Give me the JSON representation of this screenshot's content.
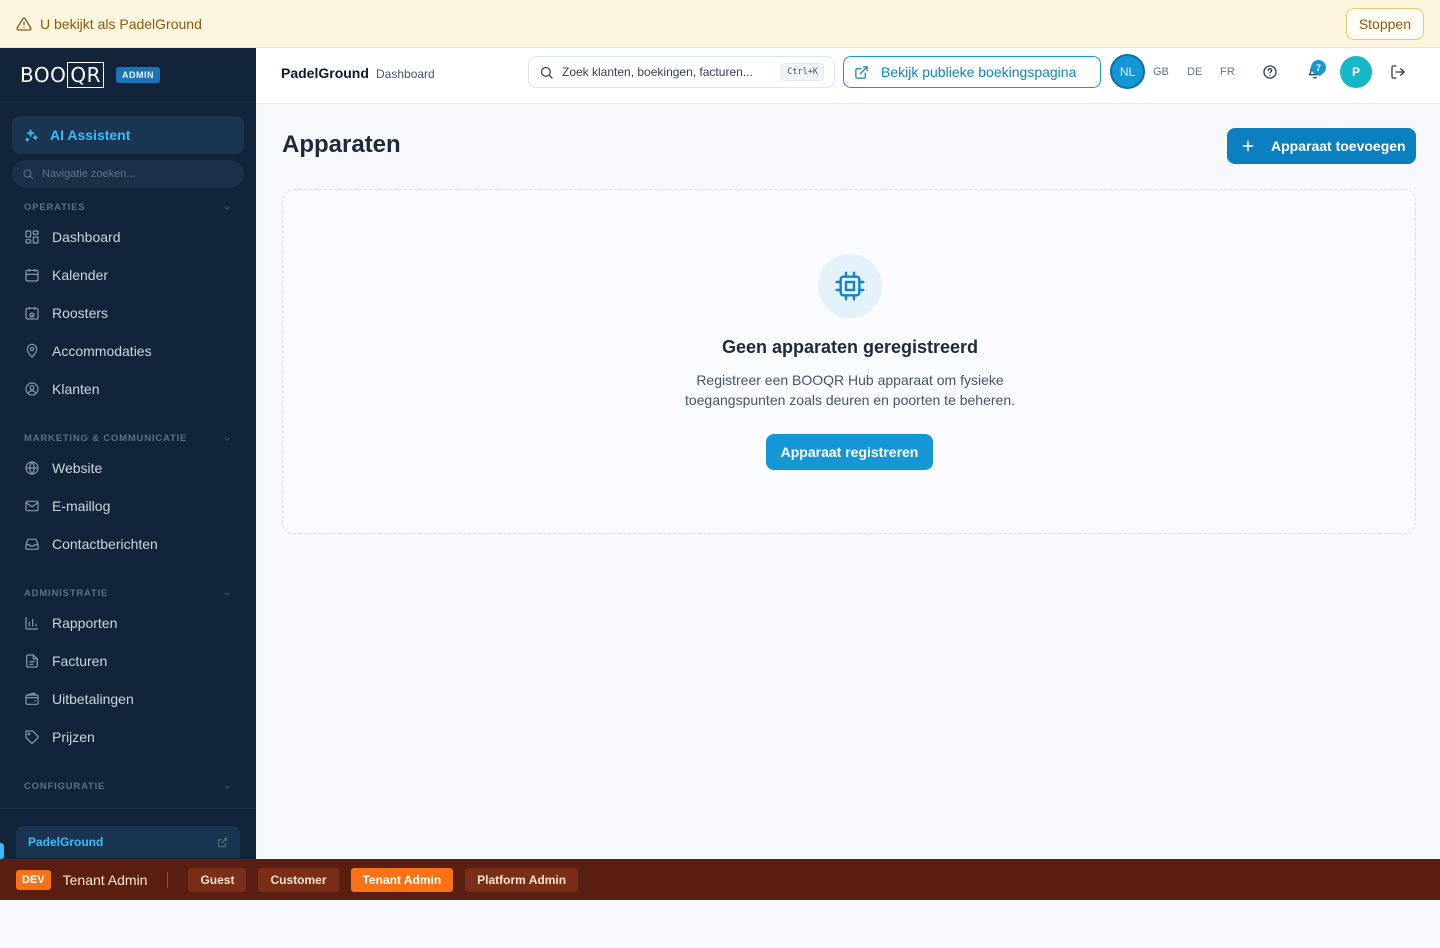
{
  "banner": {
    "text": "U bekijkt als PadelGround",
    "stop_label": "Stoppen"
  },
  "sidebar": {
    "logo": {
      "text_a": "BOO",
      "text_b": "QR"
    },
    "admin_badge": "ADMIN",
    "ai_label": "AI Assistent",
    "search_placeholder": "Navigatie zoeken...",
    "sections": [
      {
        "label": "OPERATIES"
      },
      {
        "label": "MARKETING & COMMUNICATIE"
      },
      {
        "label": "ADMINISTRATIE"
      },
      {
        "label": "CONFIGURATIE"
      }
    ],
    "items": [
      {
        "label": "Dashboard",
        "icon": "grid-icon"
      },
      {
        "label": "Kalender",
        "icon": "calendar-icon"
      },
      {
        "label": "Roosters",
        "icon": "schedule-icon"
      },
      {
        "label": "Accommodaties",
        "icon": "map-pin-icon"
      },
      {
        "label": "Klanten",
        "icon": "user-circle-icon"
      },
      {
        "label": "Website",
        "icon": "globe-icon"
      },
      {
        "label": "E-maillog",
        "icon": "mail-icon"
      },
      {
        "label": "Contactberichten",
        "icon": "inbox-icon"
      },
      {
        "label": "Rapporten",
        "icon": "bar-chart-icon"
      },
      {
        "label": "Facturen",
        "icon": "file-text-icon"
      },
      {
        "label": "Uitbetalingen",
        "icon": "wallet-icon"
      },
      {
        "label": "Prijzen",
        "icon": "tag-icon"
      }
    ],
    "tenant_label": "PadelGround"
  },
  "header": {
    "brand": "PadelGround",
    "breadcrumb": "Dashboard",
    "search_placeholder": "Zoek klanten, boekingen, facturen...",
    "shortcut": "Ctrl+K",
    "public_page_label": "Bekijk publieke boekingspagina",
    "languages": [
      "NL",
      "GB",
      "DE",
      "FR"
    ],
    "notification_count": "7",
    "avatar_initial": "P"
  },
  "main": {
    "title": "Apparaten",
    "add_button": "Apparaat toevoegen",
    "empty": {
      "title": "Geen apparaten geregistreerd",
      "desc_line1": "Registreer een BOOQR Hub apparaat om fysieke",
      "desc_line2": "toegangspunten zoals deuren en poorten te beheren.",
      "register_button": "Apparaat registreren"
    }
  },
  "devbar": {
    "badge": "DEV",
    "current_role": "Tenant Admin",
    "roles": [
      "Guest",
      "Customer",
      "Tenant Admin",
      "Platform Admin"
    ],
    "active_role": "Tenant Admin"
  },
  "colors": {
    "accent": "#1597d5",
    "sidebar": "#12243a",
    "devbar": "#5a1f12",
    "dev_accent": "#f97316"
  }
}
